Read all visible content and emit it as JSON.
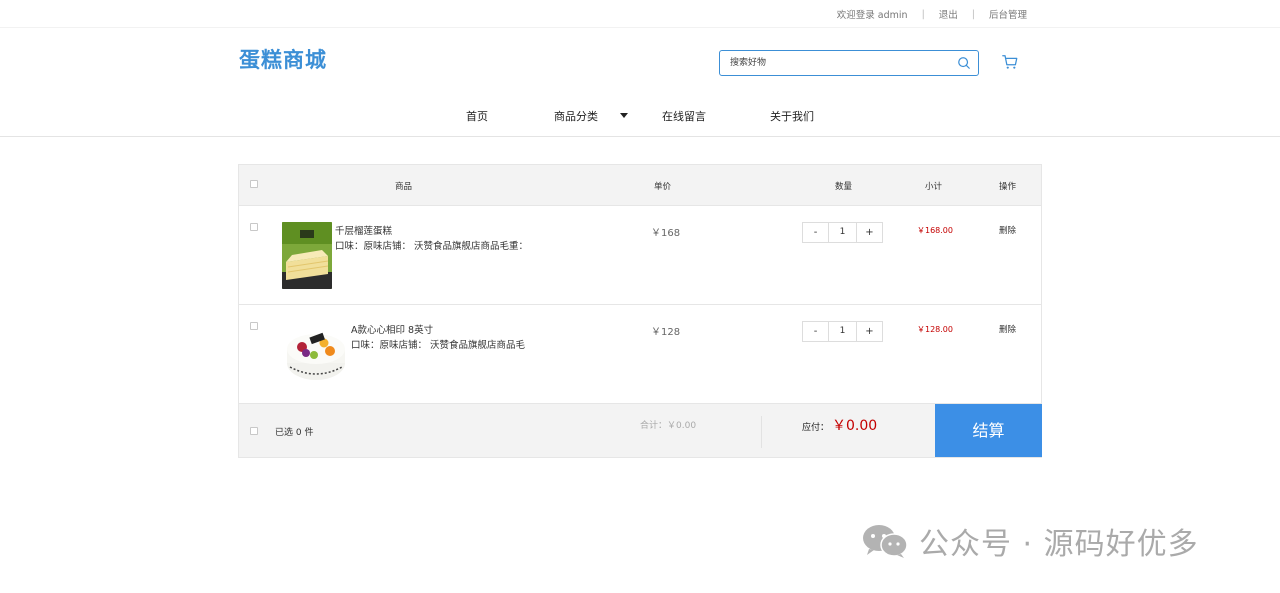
{
  "topbar": {
    "welcome": "欢迎登录 admin",
    "logout": "退出",
    "admin": "后台管理",
    "separator": "|"
  },
  "header": {
    "logo": "蛋糕商城",
    "search_placeholder": "搜索好物"
  },
  "nav": {
    "items": [
      "首页",
      "商品分类",
      "在线留言",
      "关于我们"
    ]
  },
  "cart": {
    "headers": {
      "product": "商品",
      "unit_price": "单价",
      "quantity": "数量",
      "subtotal": "小计",
      "action": "操作"
    },
    "items": [
      {
        "name": "千层榴莲蛋糕",
        "desc": "口味：原味店铺：  沃赞食品旗舰店商品毛重：",
        "price": "￥168",
        "qty_minus": "-",
        "qty": "1",
        "qty_plus": "+",
        "subtotal": "￥168.00",
        "delete": "删除"
      },
      {
        "name": "A款心心相印 8英寸",
        "desc": "口味：原味店铺：  沃赞食品旗舰店商品毛",
        "price": "￥128",
        "qty_minus": "-",
        "qty": "1",
        "qty_plus": "+",
        "subtotal": "￥128.00",
        "delete": "删除"
      }
    ],
    "footer": {
      "selected": "已选 0 件",
      "total": "合计：￥0.00",
      "pay_label": "应付：",
      "pay_amount": "￥0.00",
      "checkout": "结算"
    }
  },
  "watermark": {
    "text": "公众号 · 源码好优多"
  },
  "colors": {
    "accent": "#3c8fd6",
    "checkout_bg": "#3c8fe6",
    "price_red": "#c40000"
  }
}
